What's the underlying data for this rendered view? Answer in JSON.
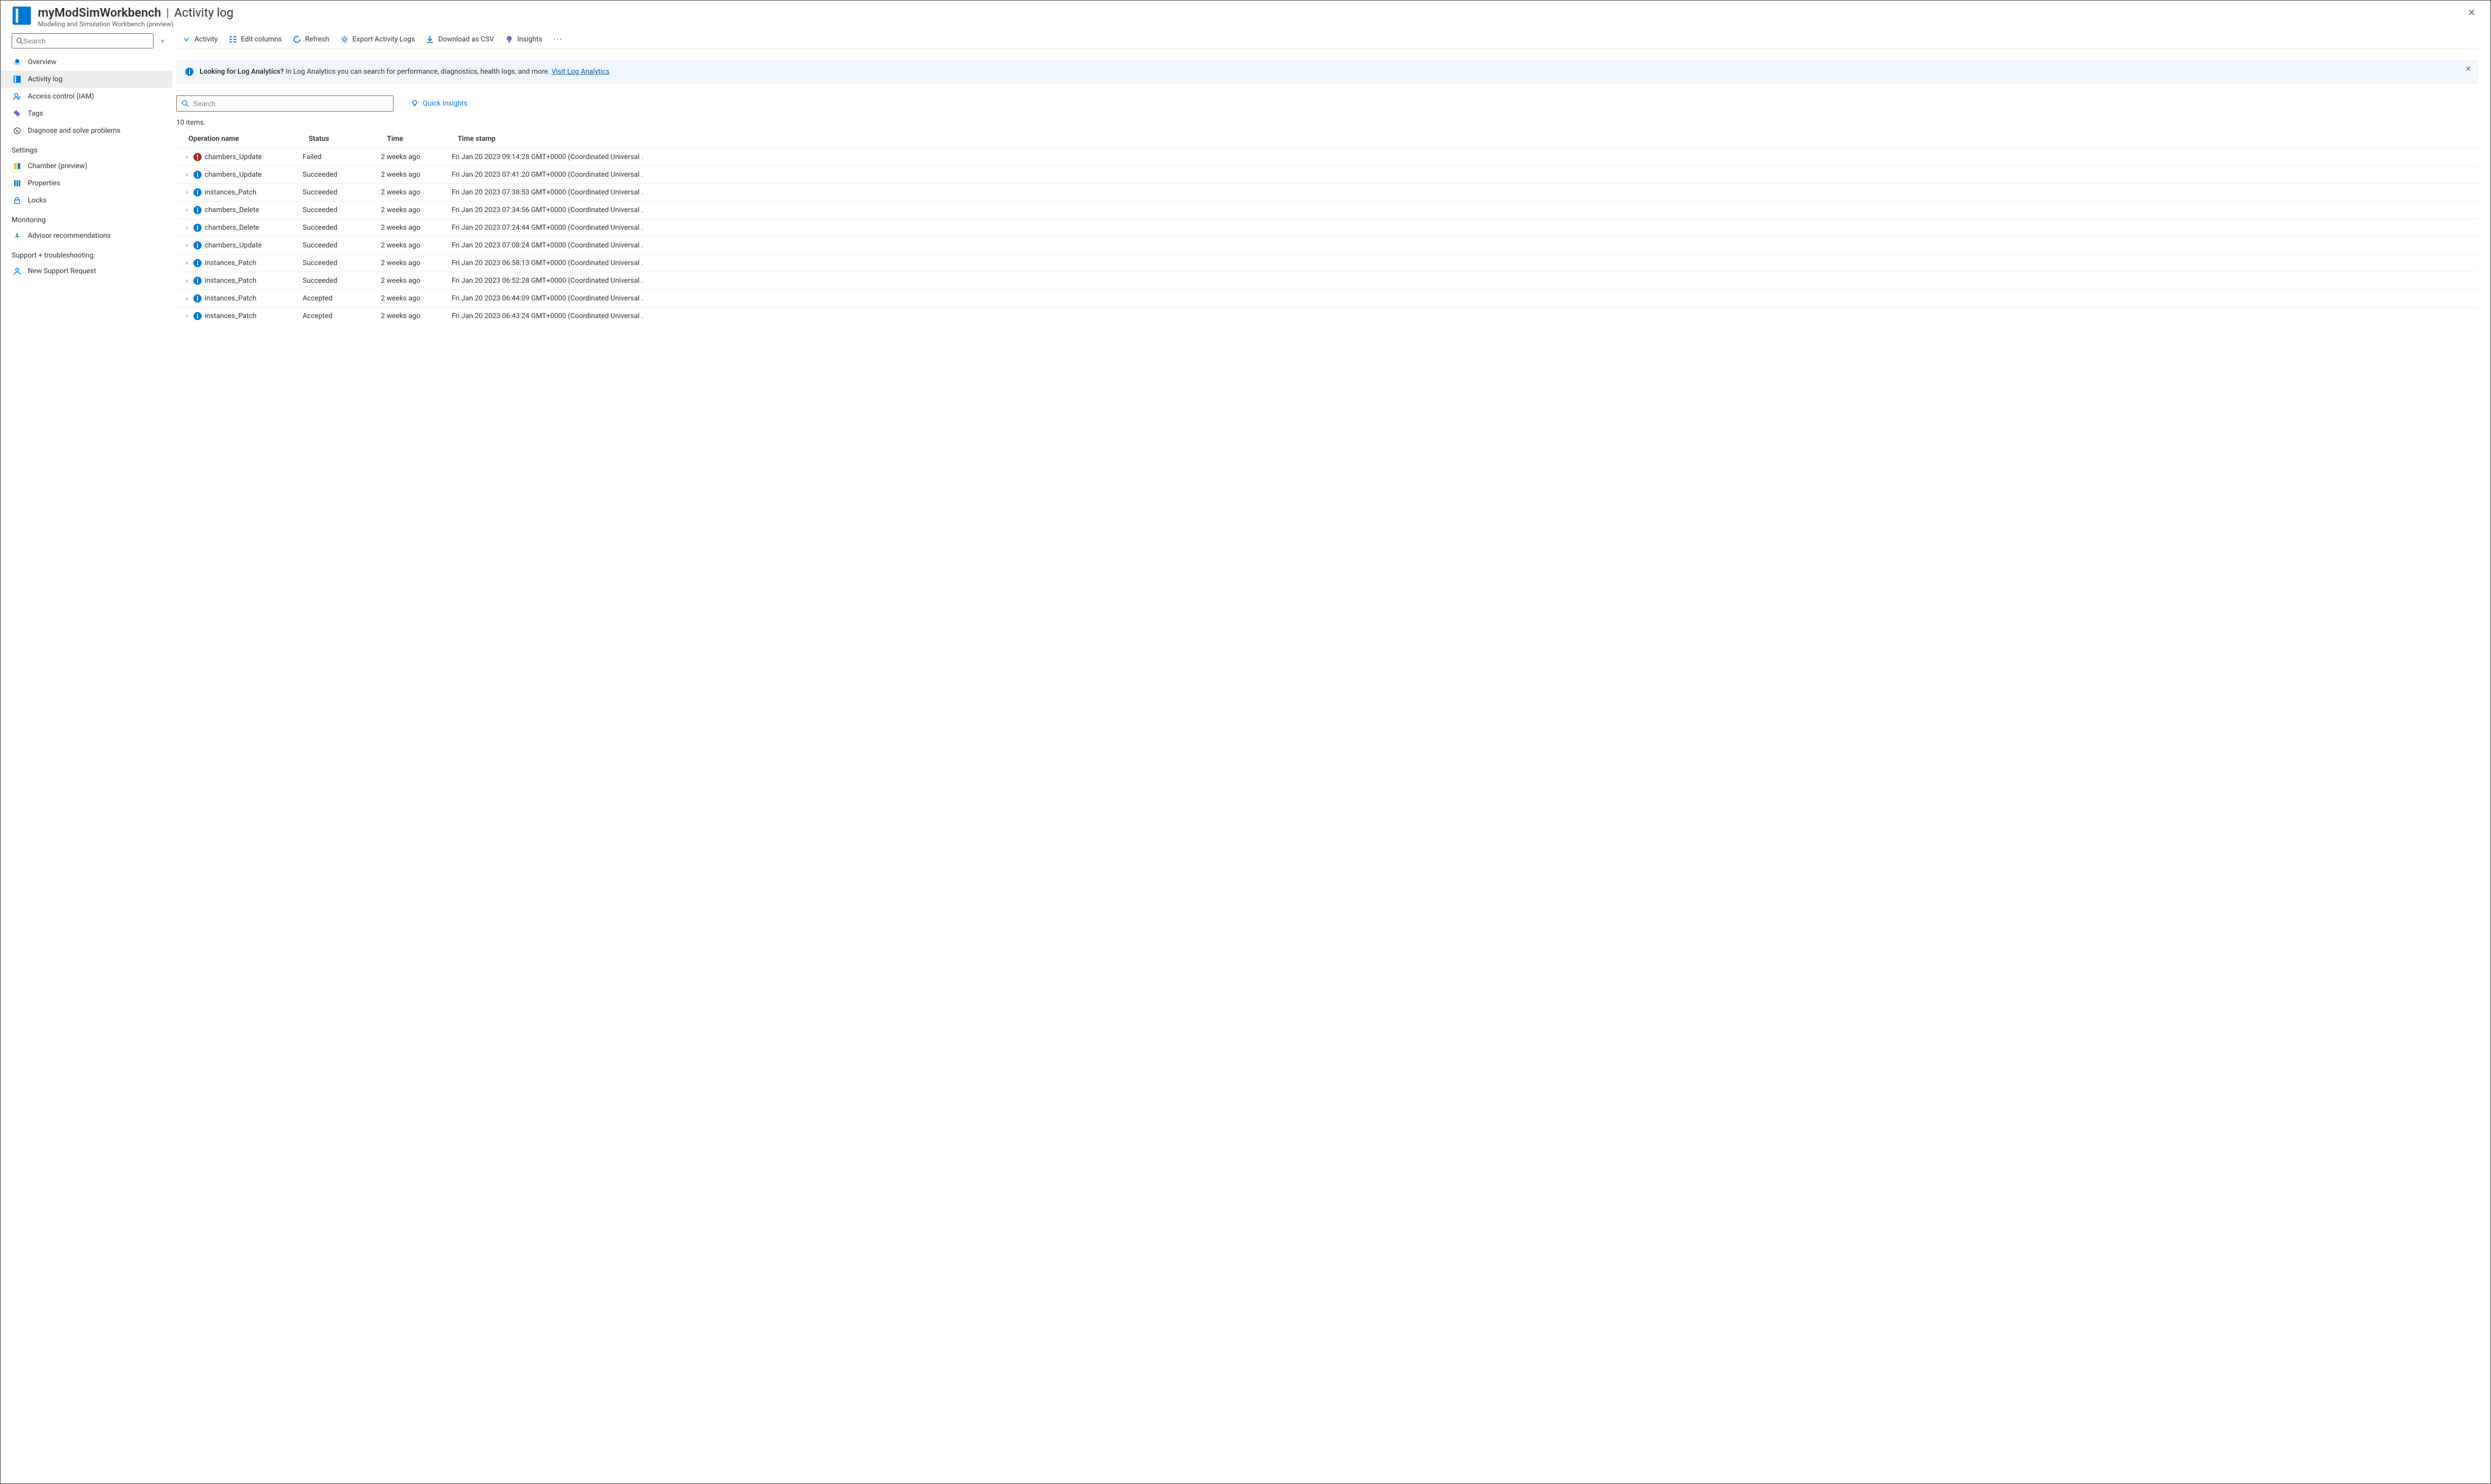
{
  "header": {
    "resource_name": "myModSimWorkbench",
    "page_title": "Activity log",
    "subtitle": "Modeling and Simulation Workbench (preview)"
  },
  "sidebar": {
    "search_placeholder": "Search",
    "items": [
      {
        "icon": "overview",
        "label": "Overview"
      },
      {
        "icon": "activity-log",
        "label": "Activity log",
        "active": true
      },
      {
        "icon": "access",
        "label": "Access control (IAM)"
      },
      {
        "icon": "tags",
        "label": "Tags"
      },
      {
        "icon": "diagnose",
        "label": "Diagnose and solve problems"
      }
    ],
    "groups": {
      "settings": {
        "label": "Settings",
        "items": [
          {
            "icon": "chamber",
            "label": "Chamber (preview)"
          },
          {
            "icon": "properties",
            "label": "Properties"
          },
          {
            "icon": "locks",
            "label": "Locks"
          }
        ]
      },
      "monitoring": {
        "label": "Monitoring",
        "items": [
          {
            "icon": "advisor",
            "label": "Advisor recommendations"
          }
        ]
      },
      "support": {
        "label": "Support + troubleshooting",
        "items": [
          {
            "icon": "support",
            "label": "New Support Request"
          }
        ]
      }
    }
  },
  "toolbar": {
    "activity": "Activity",
    "edit_columns": "Edit columns",
    "refresh": "Refresh",
    "export": "Export Activity Logs",
    "download_csv": "Download as CSV",
    "insights": "Insights"
  },
  "banner": {
    "title": "Looking for Log Analytics?",
    "text": "In Log Analytics you can search for performance, diagnostics, health logs, and more.",
    "link_text": "Visit Log Analytics"
  },
  "log_search_placeholder": "Search",
  "quick_insights_label": "Quick Insights",
  "item_count_text": "10 items.",
  "columns": {
    "operation": "Operation name",
    "status": "Status",
    "time": "Time",
    "timestamp": "Time stamp"
  },
  "rows": [
    {
      "op": "chambers_Update",
      "status": "Failed",
      "status_level": "error",
      "time": "2 weeks ago",
      "timestamp": "Fri Jan 20 2023 09:14:28 GMT+0000 (Coordinated Universal ."
    },
    {
      "op": "chambers_Update",
      "status": "Succeeded",
      "status_level": "info",
      "time": "2 weeks ago",
      "timestamp": "Fri Jan 20 2023 07:41:20 GMT+0000 (Coordinated Universal ."
    },
    {
      "op": "instances_Patch",
      "status": "Succeeded",
      "status_level": "info",
      "time": "2 weeks ago",
      "timestamp": "Fri Jan 20 2023 07:38:53 GMT+0000 (Coordinated Universal ."
    },
    {
      "op": "chambers_Delete",
      "status": "Succeeded",
      "status_level": "info",
      "time": "2 weeks ago",
      "timestamp": "Fri Jan 20 2023 07:34:56 GMT+0000 (Coordinated Universal ."
    },
    {
      "op": "chambers_Delete",
      "status": "Succeeded",
      "status_level": "info",
      "time": "2 weeks ago",
      "timestamp": "Fri Jan 20 2023 07:24:44 GMT+0000 (Coordinated Universal ."
    },
    {
      "op": "chambers_Update",
      "status": "Succeeded",
      "status_level": "info",
      "time": "2 weeks ago",
      "timestamp": "Fri Jan 20 2023 07:08:24 GMT+0000 (Coordinated Universal ."
    },
    {
      "op": "instances_Patch",
      "status": "Succeeded",
      "status_level": "info",
      "time": "2 weeks ago",
      "timestamp": "Fri Jan 20 2023 06:58:13 GMT+0000 (Coordinated Universal ."
    },
    {
      "op": "instances_Patch",
      "status": "Succeeded",
      "status_level": "info",
      "time": "2 weeks ago",
      "timestamp": "Fri Jan 20 2023 06:52:28 GMT+0000 (Coordinated Universal ."
    },
    {
      "op": "instances_Patch",
      "status": "Accepted",
      "status_level": "info",
      "time": "2 weeks ago",
      "timestamp": "Fri Jan 20 2023 06:44:09 GMT+0000 (Coordinated Universal ."
    },
    {
      "op": "instances_Patch",
      "status": "Accepted",
      "status_level": "info",
      "time": "2 weeks ago",
      "timestamp": "Fri Jan 20 2023 06:43:24 GMT+0000 (Coordinated Universal ."
    }
  ],
  "colors": {
    "primary": "#0078d4",
    "error": "#a4262c",
    "text": "#323130",
    "muted": "#605e5c"
  }
}
